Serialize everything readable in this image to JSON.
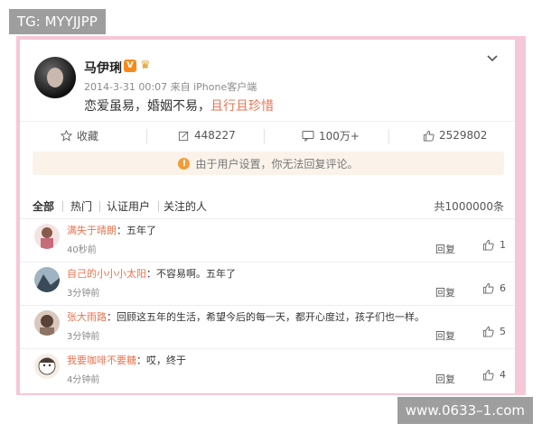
{
  "overlay": {
    "tag": "TG: MYYJJPP",
    "watermark": "www.0633–1.com"
  },
  "post": {
    "username": "马伊琍",
    "verified_badge": "V",
    "meta": "2014-3-31 00:07 来自 iPhone客户端",
    "content_main": "恋爱虽易，婚姻不易，",
    "content_highlight": "且行且珍惜"
  },
  "actions": {
    "favorite": "收藏",
    "repost": "448227",
    "comment": "100万+",
    "like": "2529802"
  },
  "notice": "由于用户设置，你无法回复评论。",
  "tabs": {
    "all": "全部",
    "hot": "热门",
    "verified": "认证用户",
    "following": "关注的人",
    "total": "共1000000条"
  },
  "comments": [
    {
      "user": "满失于晴朗",
      "text": "：五年了",
      "time": "40秒前",
      "reply": "回复",
      "likes": "1"
    },
    {
      "user": "自己的小小小太阳",
      "text": "：不容易啊。五年了",
      "time": "3分钟前",
      "reply": "回复",
      "likes": "6"
    },
    {
      "user": "张大雨路",
      "text": "：回顾这五年的生活，希望今后的每一天，都开心度过，孩子们也一样。",
      "time": "3分钟前",
      "reply": "回复",
      "likes": "5"
    },
    {
      "user": "我要咖啡不要糖",
      "text": "：哎，终于",
      "time": "4分钟前",
      "reply": "回复",
      "likes": "4"
    }
  ],
  "colors": {
    "accent": "#eb7350",
    "frame": "#f6c7d6",
    "notice_bg": "#fbf3ea"
  }
}
